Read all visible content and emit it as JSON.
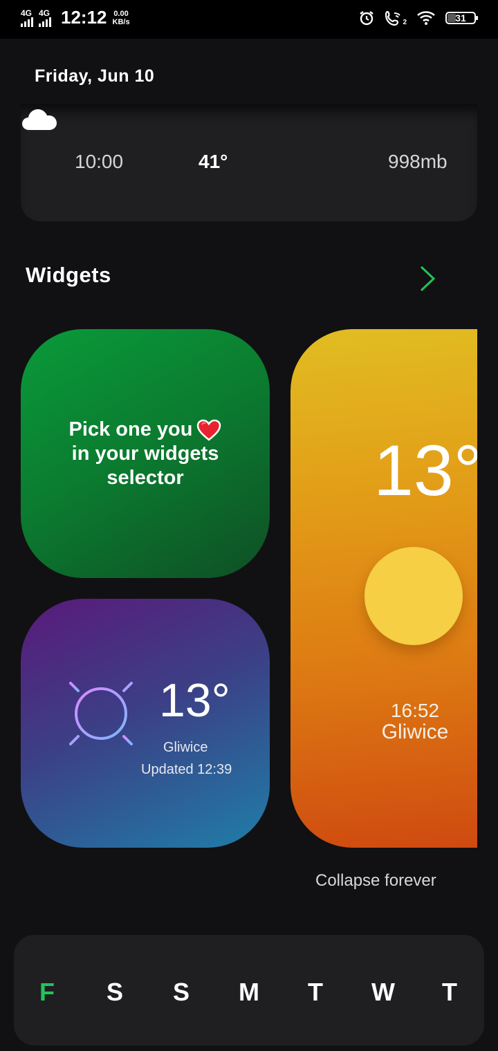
{
  "status_bar": {
    "network1": "4G",
    "network2": "4G",
    "time": "12:12",
    "speed_value": "0.00",
    "speed_unit": "KB/s",
    "call_sim": "2",
    "battery": "31",
    "icons": [
      "alarm-icon",
      "wifi-call-icon",
      "wifi-icon",
      "battery-icon"
    ]
  },
  "header": {
    "date": "Friday, Jun 10"
  },
  "weather_row": {
    "time": "10:00",
    "temperature": "41°",
    "condition_icon": "cloud-icon",
    "pressure": "998mb"
  },
  "widgets": {
    "title": "Widgets",
    "arrow_icon": "chevron-right-icon",
    "arrow_color": "#22c45a",
    "green_widget": {
      "text": "Pick one you",
      "text_line2": "in your widgets",
      "text_line3": "selector",
      "icon": "heart-icon"
    },
    "purple_widget": {
      "temperature": "13°",
      "city": "Gliwice",
      "updated": "Updated 12:39",
      "icon": "sun-icon"
    },
    "orange_widget": {
      "temperature": "13°",
      "time": "16:52",
      "city": "Gliwice",
      "icon": "sun-circle-icon"
    },
    "collapse_label": "Collapse forever"
  },
  "days": {
    "items": [
      "F",
      "S",
      "S",
      "M",
      "T",
      "W",
      "T"
    ],
    "active_index": 0,
    "active_color": "#22c45a"
  }
}
